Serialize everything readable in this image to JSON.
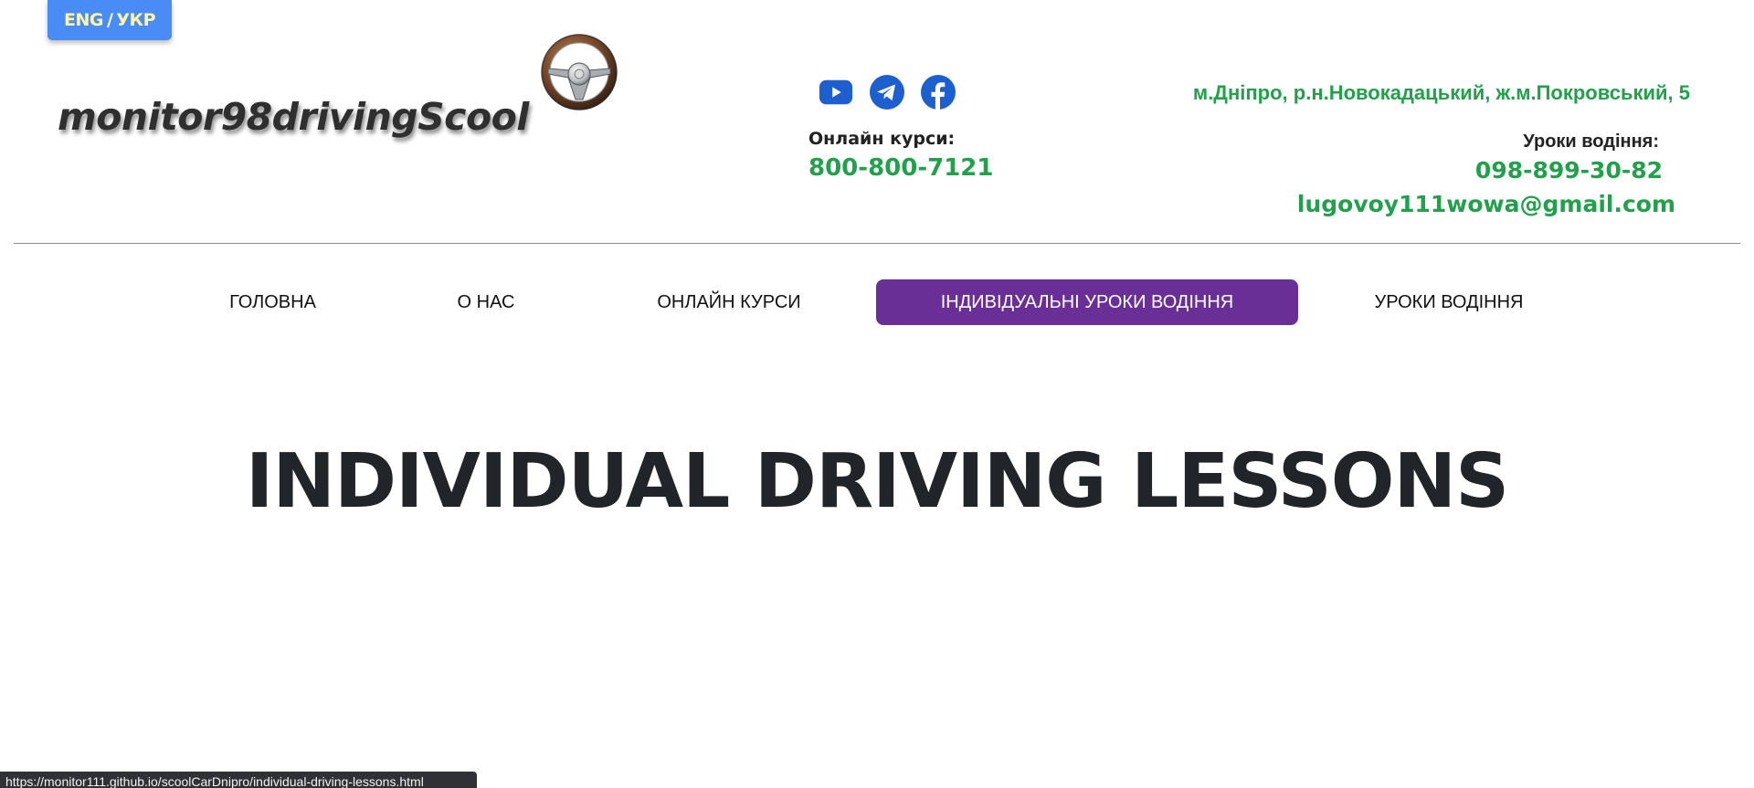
{
  "lang_toggle": {
    "eng": "ENG",
    "separator": "/",
    "ukr": "УКР"
  },
  "logo": {
    "text": "monitor98drivingScool",
    "icon": "steering-wheel-icon"
  },
  "socials": [
    {
      "name": "youtube",
      "icon": "youtube-icon",
      "color": "#1e5fcf"
    },
    {
      "name": "telegram",
      "icon": "telegram-icon",
      "color": "#1e5fcf"
    },
    {
      "name": "facebook",
      "icon": "facebook-icon",
      "color": "#1e5fcf"
    }
  ],
  "contacts": {
    "online_label": "Онлайн курси:",
    "online_phone": "800-800-7121",
    "address": "м.Дніпро, р.н.Новокадацький, ж.м.Покровський, 5",
    "lessons_label": "Уроки водіння:",
    "lessons_phone": "098-899-30-82",
    "email": "lugovoy111wowa@gmail.com"
  },
  "nav": {
    "items": [
      {
        "label": "ГОЛОВНА",
        "active": false
      },
      {
        "label": "О НАС",
        "active": false
      },
      {
        "label": "ОНЛАЙН КУРСИ",
        "active": false
      },
      {
        "label": "ІНДИВІДУАЛЬНІ УРОКИ ВОДІННЯ",
        "active": true
      },
      {
        "label": "УРОКИ ВОДІННЯ",
        "active": false
      }
    ]
  },
  "hero": {
    "title": "INDIVIDUAL DRIVING LESSONS"
  },
  "status_bar": {
    "url": "https://monitor111.github.io/scoolCarDnipro/individual-driving-lessons.html"
  },
  "colors": {
    "accent_green": "#22a04b",
    "nav_active": "#6a2f96",
    "lang_button": "#4a8cf5",
    "lang_text": "#fff6a8"
  }
}
